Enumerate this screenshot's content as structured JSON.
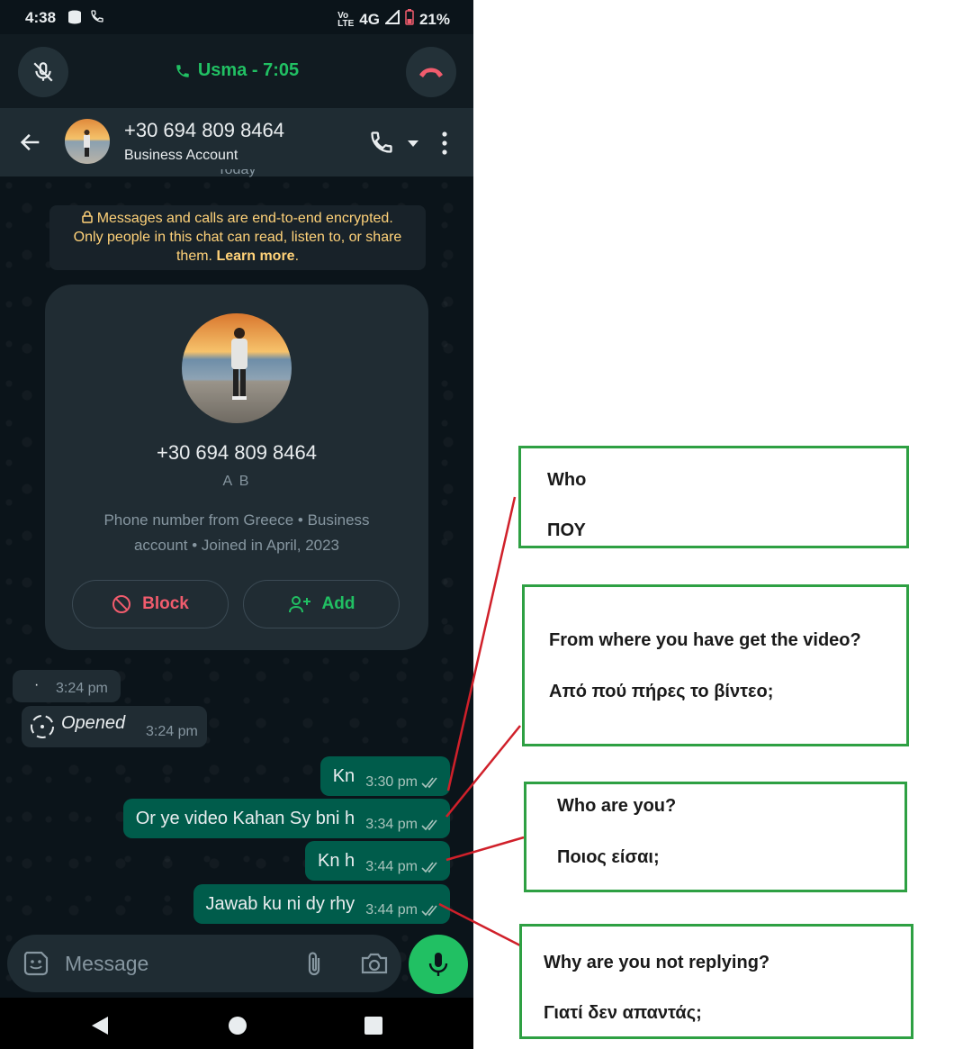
{
  "status_bar": {
    "time": "4:38",
    "network": "4G",
    "battery": "21%"
  },
  "call_bar": {
    "title": "Usma - 7:05"
  },
  "header": {
    "contact_name": "+30 694 809 8464",
    "subtitle": "Business Account"
  },
  "chat": {
    "date_chip": "Today",
    "encryption_notice": {
      "line1": "Messages and calls are end-to-end encrypted.",
      "line2": "Only people in this chat can read, listen to, or share",
      "line3_prefix": "them.",
      "learn_more": "Learn more",
      "line3_suffix": "."
    },
    "contact_card": {
      "phone": "+30 694 809 8464",
      "display_name": "A B",
      "info_line1": "Phone number from Greece • Business",
      "info_line2": "account • Joined in April, 2023",
      "block_label": "Block",
      "add_label": "Add"
    },
    "incoming": [
      {
        "text": "·",
        "time": "3:24 pm"
      },
      {
        "text": "Opened",
        "time": "3:24 pm"
      }
    ],
    "outgoing": [
      {
        "text": "Kn",
        "time": "3:30 pm",
        "status": "read"
      },
      {
        "text": "Or ye video Kahan Sy bni h",
        "time": "3:34 pm",
        "status": "read"
      },
      {
        "text": "Kn h",
        "time": "3:44 pm",
        "status": "read"
      },
      {
        "text": "Jawab ku ni dy rhy",
        "time": "3:44 pm",
        "status": "read"
      }
    ]
  },
  "composer": {
    "placeholder": "Message"
  },
  "annotations": [
    {
      "english": "Who",
      "greek": "ΠΟΥ"
    },
    {
      "english": "From where you have get the video?",
      "greek": "Από πού πήρες το βίντεο;"
    },
    {
      "english": "Who are you?",
      "greek": "Ποιος είσαι;"
    },
    {
      "english": "Why are you not replying?",
      "greek": "Γιατί δεν απαντάς;"
    }
  ],
  "colors": {
    "chat_bg": "#0b141a",
    "header_bg": "#1f2c33",
    "outgoing_bubble": "#005c4b",
    "incoming_bubble": "#202c33",
    "accent_green": "#21c063",
    "block_red": "#f15c6d",
    "encryption_text": "#ffd279",
    "annotation_border": "#2ea043",
    "connector_red": "#d0202a"
  }
}
